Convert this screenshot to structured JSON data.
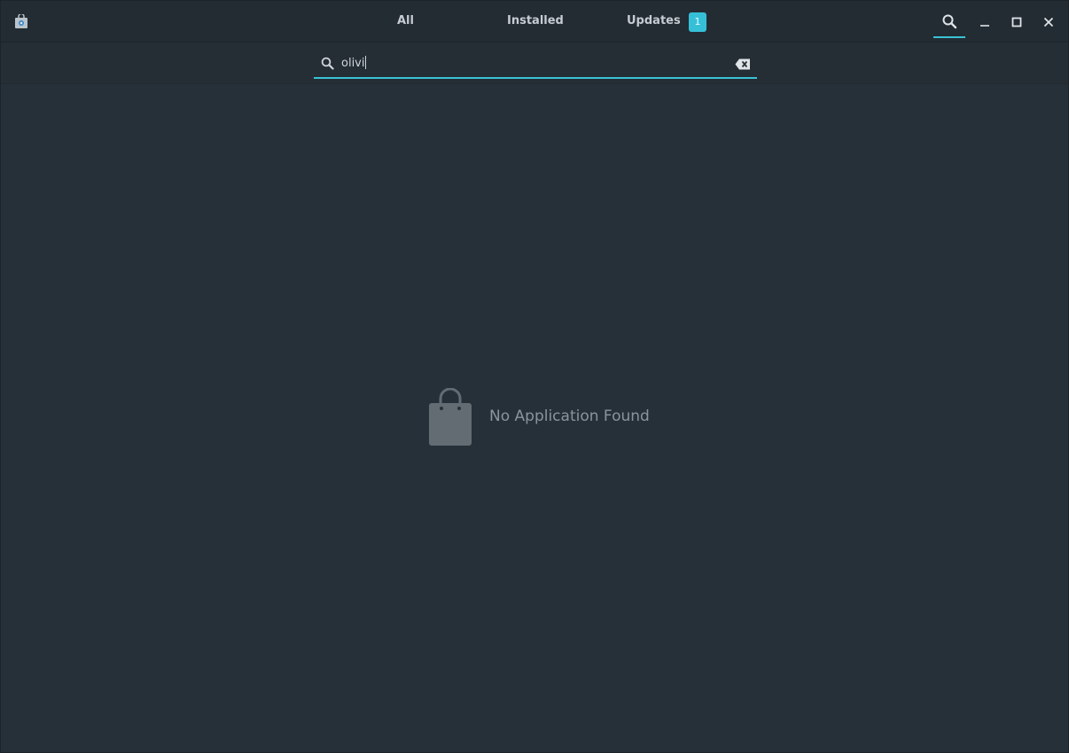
{
  "headerbar": {
    "tabs": [
      {
        "label": "All"
      },
      {
        "label": "Installed"
      },
      {
        "label": "Updates",
        "badge": "1"
      }
    ],
    "icons": {
      "app": "app-store-icon",
      "search": "search-icon",
      "minimize": "minimize-icon",
      "maximize": "maximize-icon",
      "close": "close-icon"
    },
    "accent_color": "#36c0d8"
  },
  "search": {
    "value": "olivi",
    "icon": "search-icon",
    "clear_icon": "backspace-clear-icon"
  },
  "empty_state": {
    "icon": "shopping-bag-icon",
    "message": "No Application Found"
  }
}
